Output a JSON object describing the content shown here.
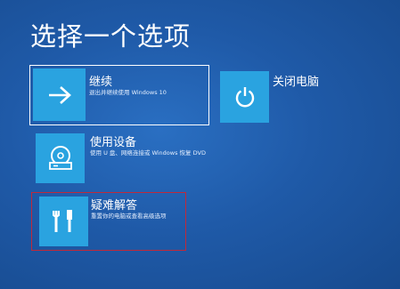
{
  "title": "选择一个选项",
  "options": {
    "continue": {
      "label": "继续",
      "description": "退出并继续使用 Windows 10",
      "icon": "arrow-right-icon",
      "selected": true
    },
    "shutdown": {
      "label": "关闭电脑",
      "icon": "power-icon"
    },
    "use_device": {
      "label": "使用设备",
      "description": "使用 U 盘、网络连接或 Windows 恢复 DVD",
      "icon": "disc-drive-icon"
    },
    "troubleshoot": {
      "label": "疑难解答",
      "description": "重置你的电脑或查看高级选项",
      "icon": "tools-icon",
      "highlight_color": "#c0293a"
    }
  },
  "colors": {
    "background": "#1f5aa8",
    "tile": "#2aa3e0"
  }
}
